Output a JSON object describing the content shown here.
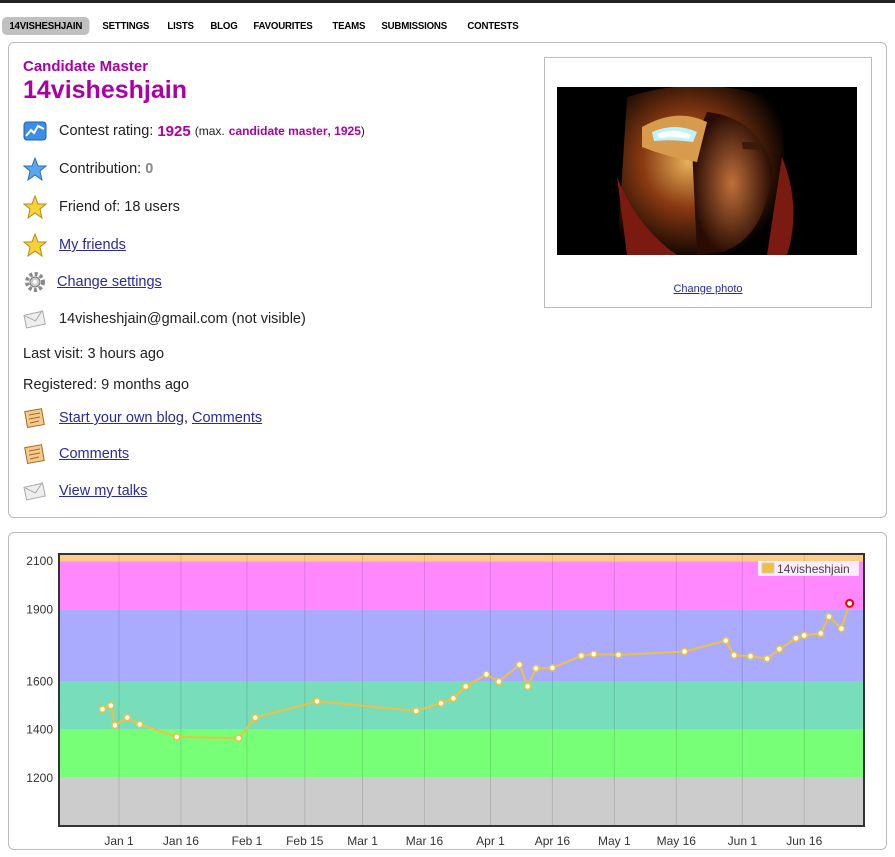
{
  "menu": [
    "14VISHESHJAIN",
    "SETTINGS",
    "LISTS",
    "BLOG",
    "FAVOURITES",
    "TEAMS",
    "SUBMISSIONS",
    "CONTESTS"
  ],
  "profile": {
    "rank": "Candidate Master",
    "handle": "14visheshjain",
    "rating_label": "Contest rating:",
    "rating": "1925",
    "max_prefix": "(max.",
    "max_rank": "candidate master",
    "max_rating": "1925",
    "max_suffix": ")",
    "contribution_label": "Contribution:",
    "contribution": "0",
    "friend_of": "Friend of: 18 users",
    "my_friends": "My friends",
    "change_settings": "Change settings",
    "email": "14visheshjain@gmail.com (not visible)",
    "last_visit": "Last visit: 3 hours ago",
    "registered": "Registered: 9 months ago",
    "start_blog": "Start your own blog",
    "comments": "Comments",
    "comments2": "Comments",
    "view_talks": "View my talks",
    "change_photo": "Change photo"
  },
  "colors": {
    "rank": "#aa00aa",
    "link": "#2a2aa0"
  },
  "chart_data": {
    "type": "line",
    "legend": "14visheshjain",
    "legend_position": "top-right",
    "y_ticks": [
      1200,
      1400,
      1600,
      1900,
      2100
    ],
    "x_ticks": [
      "Jan 1",
      "Jan 16",
      "Feb 1",
      "Feb 15",
      "Mar 1",
      "Mar 16",
      "Apr 1",
      "Apr 16",
      "May 1",
      "May 16",
      "Jun 1",
      "Jun 16"
    ],
    "ylim": [
      1000,
      2130
    ],
    "bands": [
      {
        "from": 1000,
        "to": 1200,
        "color": "#cccccc"
      },
      {
        "from": 1200,
        "to": 1400,
        "color": "#77ff77"
      },
      {
        "from": 1400,
        "to": 1600,
        "color": "#77ddbb"
      },
      {
        "from": 1600,
        "to": 1900,
        "color": "#aaaaff"
      },
      {
        "from": 1900,
        "to": 2100,
        "color": "#ff88ff"
      },
      {
        "from": 2100,
        "to": 2130,
        "color": "#ffcc88"
      }
    ],
    "points": [
      [
        "Dec 28",
        1485
      ],
      [
        "Dec 30",
        1500
      ],
      [
        "Dec 31",
        1418
      ],
      [
        "Jan 3",
        1450
      ],
      [
        "Jan 6",
        1422
      ],
      [
        "Jan 15",
        1370
      ],
      [
        "Jan 30",
        1365
      ],
      [
        "Feb 3",
        1450
      ],
      [
        "Feb 18",
        1518
      ],
      [
        "Mar 14",
        1478
      ],
      [
        "Mar 20",
        1510
      ],
      [
        "Mar 23",
        1530
      ],
      [
        "Mar 26",
        1580
      ],
      [
        "Mar 31",
        1630
      ],
      [
        "Apr 3",
        1600
      ],
      [
        "Apr 8",
        1670
      ],
      [
        "Apr 10",
        1580
      ],
      [
        "Apr 12",
        1655
      ],
      [
        "Apr 16",
        1657
      ],
      [
        "Apr 23",
        1707
      ],
      [
        "Apr 26",
        1714
      ],
      [
        "May 2",
        1711
      ],
      [
        "May 18",
        1725
      ],
      [
        "May 28",
        1770
      ],
      [
        "May 30",
        1710
      ],
      [
        "Jun 3",
        1705
      ],
      [
        "Jun 7",
        1695
      ],
      [
        "Jun 10",
        1735
      ],
      [
        "Jun 14",
        1780
      ],
      [
        "Jun 16",
        1792
      ],
      [
        "Jun 20",
        1800
      ],
      [
        "Jun 22",
        1870
      ],
      [
        "Jun 25",
        1820
      ],
      [
        "Jun 27",
        1925
      ]
    ]
  }
}
